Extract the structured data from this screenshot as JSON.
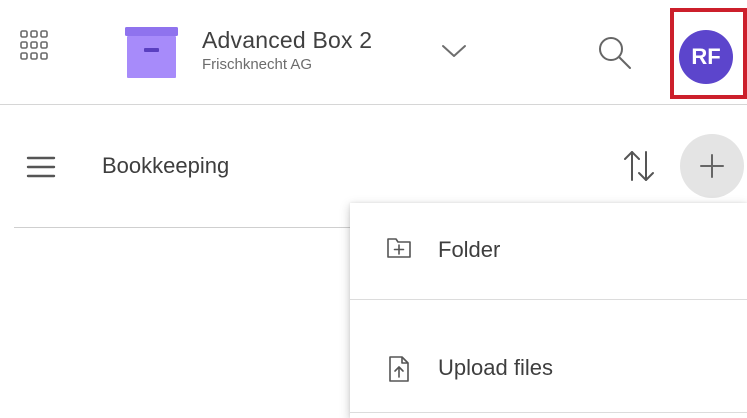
{
  "header": {
    "title": "Advanced Box 2",
    "subtitle": "Frischknecht AG",
    "avatar_initials": "RF",
    "colors": {
      "box_icon": "#a78bfa",
      "box_icon_band": "#8f73ee",
      "avatar_bg": "#5c45cc",
      "highlight_border": "#cc1f2b"
    },
    "icons": [
      "apps-grid-icon",
      "archive-box-icon",
      "chevron-down-icon",
      "search-icon"
    ]
  },
  "toolbar": {
    "section_title": "Bookkeeping",
    "icons": [
      "menu-icon",
      "sort-icon",
      "plus-icon"
    ]
  },
  "dropdown": {
    "items": [
      {
        "label": "Folder",
        "icon": "folder-plus-icon"
      },
      {
        "label": "Upload files",
        "icon": "file-upload-icon"
      }
    ]
  }
}
